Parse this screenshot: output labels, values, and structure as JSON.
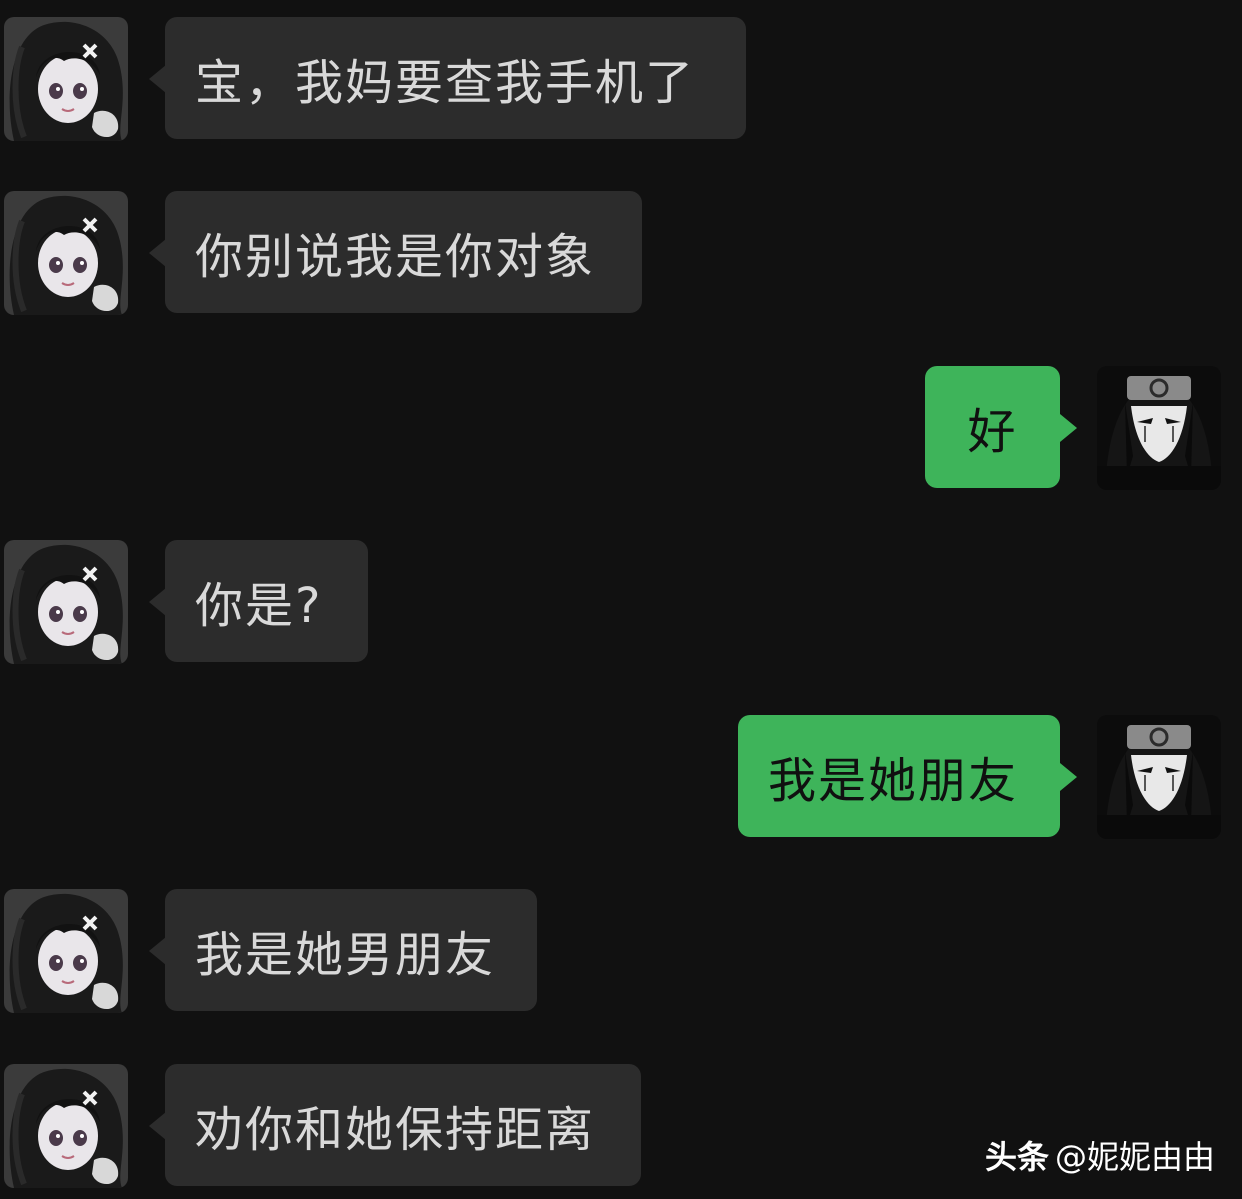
{
  "messages": [
    {
      "side": "left",
      "text": "宝，我妈要查我手机了"
    },
    {
      "side": "left",
      "text": "你别说我是你对象"
    },
    {
      "side": "right",
      "text": "好"
    },
    {
      "side": "left",
      "text": "你是?"
    },
    {
      "side": "right",
      "text": "我是她朋友"
    },
    {
      "side": "left",
      "text": "我是她男朋友"
    },
    {
      "side": "left",
      "text": "劝你和她保持距离"
    }
  ],
  "avatars": {
    "left_icon": "anime-girl-avatar-icon",
    "right_icon": "ninja-avatar-icon"
  },
  "watermark": {
    "brand": "头条",
    "handle": "@妮妮由由"
  },
  "colors": {
    "background": "#111111",
    "left_bubble": "#2c2c2c",
    "left_text": "#d9d9d9",
    "right_bubble": "#3eb45a",
    "right_text": "#101010"
  }
}
